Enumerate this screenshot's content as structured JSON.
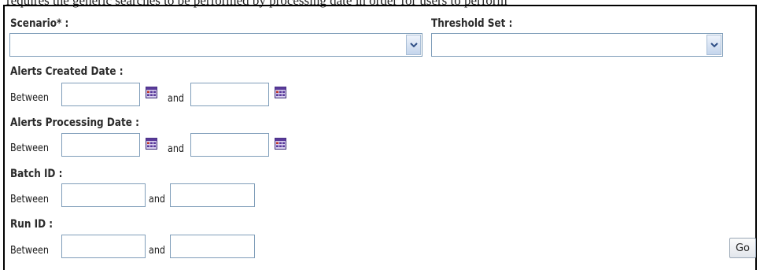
{
  "top_strip_text": "requires the generic searches to be performed by processing date in order for users to perform",
  "scenario": {
    "label": "Scenario* :",
    "value": ""
  },
  "threshold_set": {
    "label": "Threshold Set :",
    "value": ""
  },
  "alerts_created_date": {
    "label": "Alerts Created Date :",
    "between": "Between",
    "and": "and",
    "from": "",
    "to": ""
  },
  "alerts_processing_date": {
    "label": "Alerts Processing Date :",
    "between": "Between",
    "and": "and",
    "from": "",
    "to": ""
  },
  "batch_id": {
    "label": "Batch ID :",
    "between": "Between",
    "and": "and",
    "from": "",
    "to": ""
  },
  "run_id": {
    "label": "Run ID :",
    "between": "Between",
    "and": "and",
    "from": "",
    "to": ""
  },
  "go_button": "Go",
  "icons": {
    "dropdown": "chevron-down-icon",
    "calendar": "calendar-icon"
  },
  "colors": {
    "input_border": "#7f9db9",
    "calendar_purple": "#5a3a9a"
  }
}
